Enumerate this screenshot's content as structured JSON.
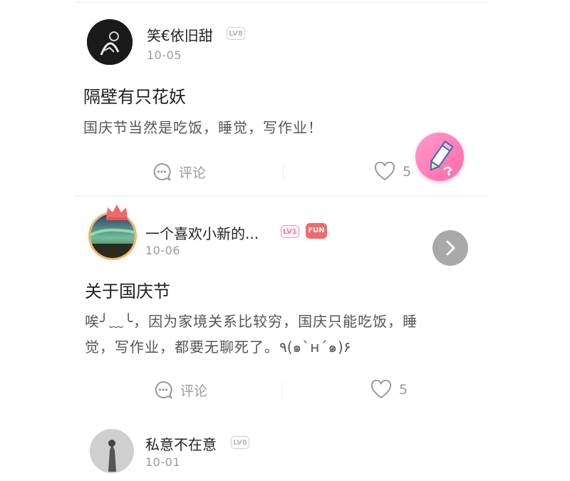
{
  "posts": [
    {
      "username": "笑€依旧甜",
      "level": "LV8",
      "date": "10-05",
      "title": "隔壁有只花妖",
      "body": "国庆节当然是吃饭，睡觉，写作业！",
      "comment_label": "评论",
      "likes": "5"
    },
    {
      "username": "一个喜欢小新的...",
      "level": "LV1",
      "fun_badge": "FUN",
      "date": "10-06",
      "title": "关于国庆节",
      "body_line1": "唉╯﹏╰，因为家境关系比较穷，国庆只能吃饭，睡",
      "body_line2": "觉，写作业，都要无聊死了。٩(๑`н´๑)۶",
      "comment_label": "评论",
      "likes": "5"
    },
    {
      "username": "私意不在意",
      "level": "LV8",
      "date": "10-01"
    }
  ],
  "colors": {
    "accent_pink": "#ff69a8",
    "muted_text": "#9a9a9a"
  },
  "icons": {
    "comment": "comment-bubble-icon",
    "like": "heart-icon",
    "write": "pencil-icon",
    "next": "chevron-right-icon"
  }
}
